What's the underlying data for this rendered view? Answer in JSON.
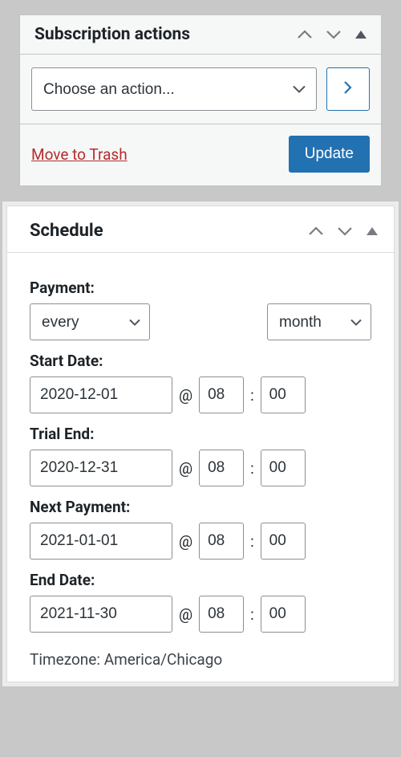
{
  "actions": {
    "title": "Subscription actions",
    "select_placeholder": "Choose an action...",
    "trash_label": "Move to Trash",
    "update_label": "Update"
  },
  "schedule": {
    "title": "Schedule",
    "payment_label": "Payment:",
    "frequency": "every",
    "period": "month",
    "start": {
      "label": "Start Date:",
      "date": "2020-12-01",
      "hour": "08",
      "minute": "00"
    },
    "trial": {
      "label": "Trial End:",
      "date": "2020-12-31",
      "hour": "08",
      "minute": "00"
    },
    "next": {
      "label": "Next Payment:",
      "date": "2021-01-01",
      "hour": "08",
      "minute": "00"
    },
    "end": {
      "label": "End Date:",
      "date": "2021-11-30",
      "hour": "08",
      "minute": "00"
    },
    "tz_prefix": "Timezone: ",
    "tz_value": "America/Chicago"
  },
  "glyphs": {
    "at": "@",
    "colon": ":"
  }
}
